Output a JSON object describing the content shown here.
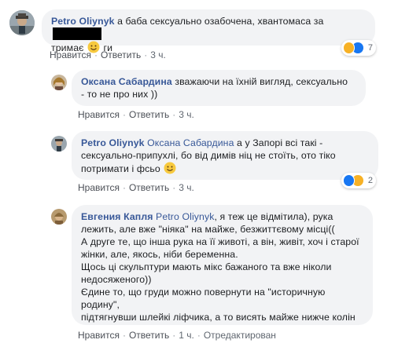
{
  "colors": {
    "link": "#385898",
    "bubble": "#f2f3f5",
    "meta": "#606770",
    "like": "#1877f2",
    "haha": "#f7b125"
  },
  "comments": [
    {
      "author": "Petro Oliynyk",
      "text_line1": " а баба сексуально озабочена, хвантомаса за",
      "text_line2_pre": "тримає ",
      "text_line2_post": " ги",
      "redacted": true,
      "actions": {
        "like": "Нравится",
        "reply": "Ответить",
        "time": "3 ч."
      },
      "reactions": {
        "icons": [
          "haha-icon",
          "like-icon"
        ],
        "count": "7"
      }
    },
    {
      "author": "Оксана Сабардина",
      "text_line1": " зважаючи на їхній вигляд, сексуально",
      "text_line2": "- то не про них ))",
      "actions": {
        "like": "Нравится",
        "reply": "Ответить",
        "time": "3 ч."
      }
    },
    {
      "author": "Petro Oliynyk",
      "mention": "Оксана Сабардина",
      "text_line1": " а у Запорі всі такі -",
      "text_line2": "сексуально-припухлі, бо від димів ніц не стоїть, ото тіко",
      "text_line3_pre": "потримати і фсьо ",
      "actions": {
        "like": "Нравится",
        "reply": "Ответить",
        "time": "3 ч."
      },
      "reactions": {
        "icons": [
          "like-icon",
          "haha-icon"
        ],
        "count": "2"
      }
    },
    {
      "author": "Евгения Капля",
      "mention": "Petro Oliynyk",
      "lines": [
        ", я теж це відмітила), рука",
        "лежить, але вже \"ніяка\" на майже, безжиттєвому місці((",
        "А друге те, що інша рука на її животі, а він, живіт, хоч і старої",
        "жінки, але, якось, ніби беременна.",
        "Щось ці скульптури мають мікс бажаного та вже ніколи",
        "недосяженого))",
        "Єдине то, що груди можно повернути на \"историчную",
        "родину\",",
        "підтягнувши шлейкі ліфчика, а то висять майже нижче колін"
      ],
      "actions": {
        "like": "Нравится",
        "reply": "Ответить",
        "time": "1 ч.",
        "edited": "Отредактирован"
      }
    }
  ]
}
